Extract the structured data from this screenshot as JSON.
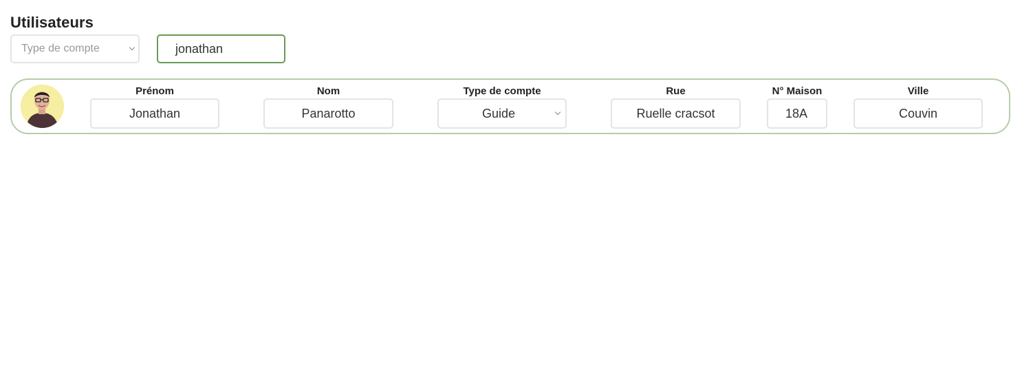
{
  "page": {
    "title": "Utilisateurs"
  },
  "filters": {
    "account_type_placeholder": "Type de compte",
    "search_value": "jonathan"
  },
  "user_card": {
    "avatar_alt": "avatar",
    "fields": {
      "first_name": {
        "label": "Prénom",
        "value": "Jonathan"
      },
      "last_name": {
        "label": "Nom",
        "value": "Panarotto"
      },
      "account_type": {
        "label": "Type de compte",
        "value": "Guide"
      },
      "street": {
        "label": "Rue",
        "value": "Ruelle cracsot"
      },
      "house_number": {
        "label": "N° Maison",
        "value": "18A"
      },
      "city": {
        "label": "Ville",
        "value": "Couvin"
      }
    }
  },
  "colors": {
    "accent_green": "#6a9a52",
    "card_border": "#b7cca6",
    "input_border": "#e4e4e4",
    "avatar_bg": "#f6eea0"
  },
  "icons": {
    "dropdown": "chevron-down-icon"
  }
}
